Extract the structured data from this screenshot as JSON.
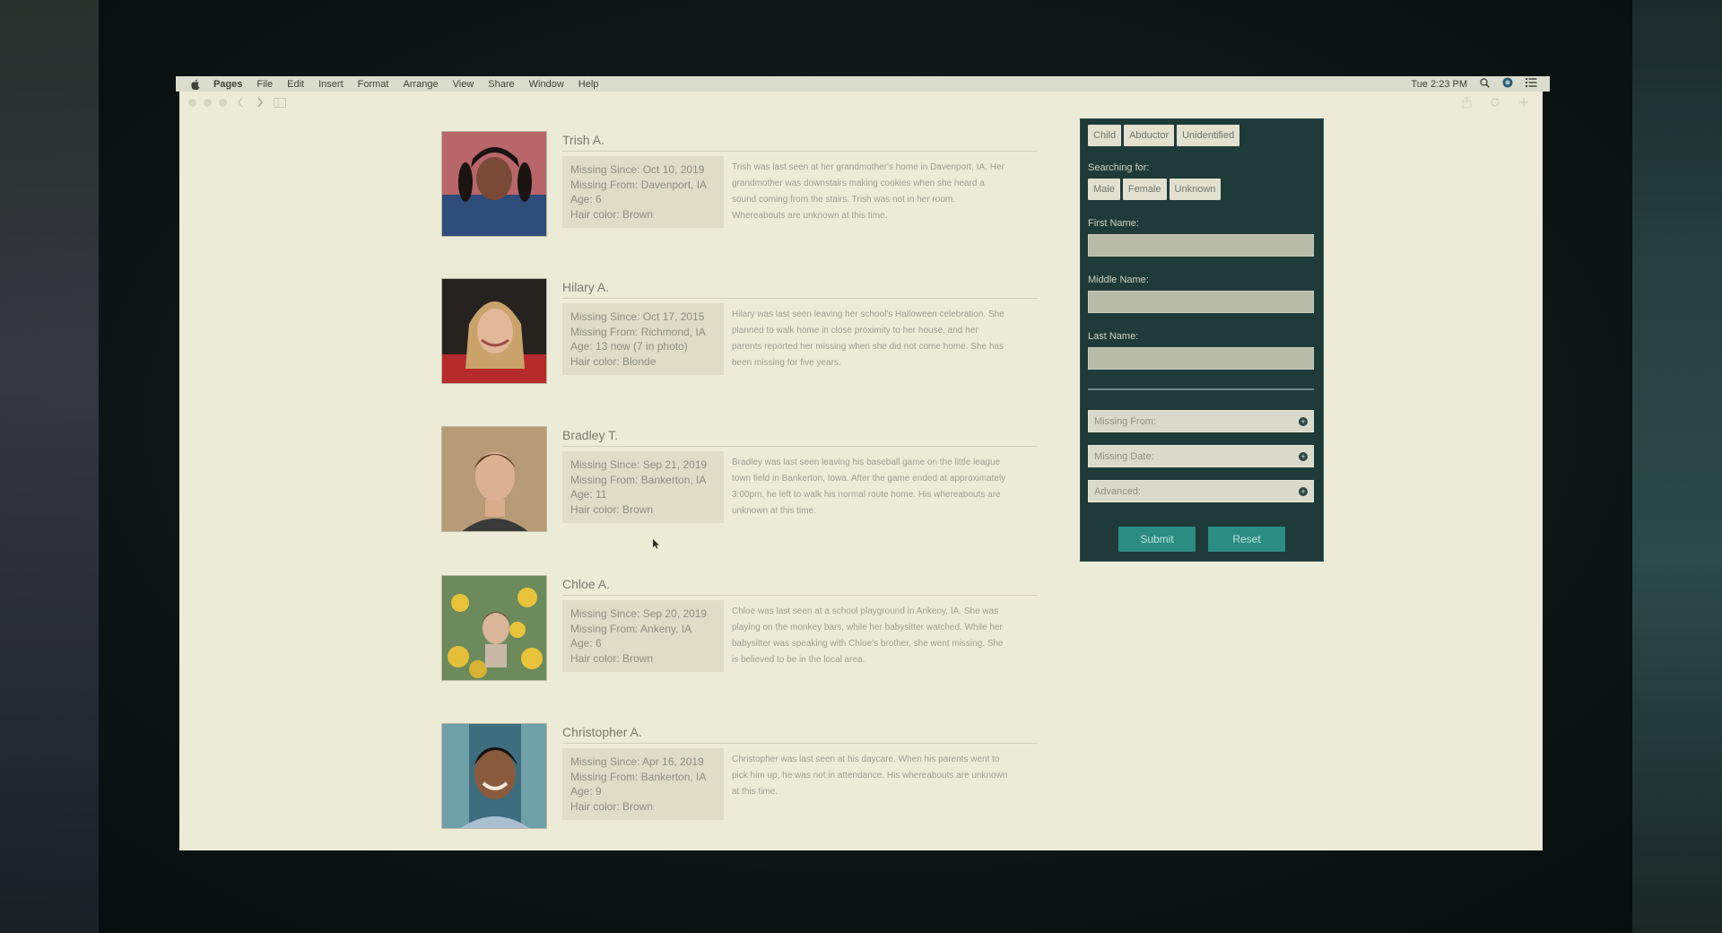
{
  "menubar": {
    "app": "Pages",
    "items": [
      "File",
      "Edit",
      "Insert",
      "Format",
      "Arrange",
      "View",
      "Share",
      "Window",
      "Help"
    ],
    "clock": "Tue 2:23 PM"
  },
  "profiles": [
    {
      "name": "Trish A.",
      "missing_since": "Missing Since: Oct 10, 2019",
      "missing_from": "Missing From: Davenport, IA",
      "age": "Age: 6",
      "hair": "Hair color: Brown",
      "description": "Trish was last seen at her grandmother's home in Davenport, IA. Her grandmother was downstairs making cookies when she heard a sound coming from the stairs. Trish was not in her room. Whereabouts are unknown at this time."
    },
    {
      "name": "Hilary A.",
      "missing_since": "Missing Since: Oct 17, 2015",
      "missing_from": "Missing From: Richmond, IA",
      "age": "Age: 13 now (7 in photo)",
      "hair": "Hair color: Blonde",
      "description": "Hilary was last seen leaving her school's Halloween celebration. She planned to walk home in close proximity to her house, and her parents reported her missing when she did not come home. She has been missing for five years."
    },
    {
      "name": "Bradley T.",
      "missing_since": "Missing Since: Sep 21, 2019",
      "missing_from": "Missing From: Bankerton, IA",
      "age": "Age: 11",
      "hair": "Hair color: Brown",
      "description": "Bradley was last seen leaving his baseball game on the little league town field in Bankerton, Iowa. After the game ended at approximately 3:00pm, he left to walk his normal route home. His whereabouts are unknown at this time."
    },
    {
      "name": "Chloe A.",
      "missing_since": "Missing Since: Sep 20, 2019",
      "missing_from": "Missing From: Ankeny, IA",
      "age": "Age: 6",
      "hair": "Hair color: Brown",
      "description": "Chloe was last seen at a school playground in Ankeny, IA. She was playing on the monkey bars, while her babysitter watched. While her babysitter was speaking with Chloe's brother, she went missing. She is believed to be in the local area."
    },
    {
      "name": "Christopher A.",
      "missing_since": "Missing Since: Apr 16, 2019",
      "missing_from": "Missing From: Bankerton, IA",
      "age": "Age: 9",
      "hair": "Hair color: Brown",
      "description": "Christopher was last seen at his daycare. When his parents went to pick him up, he was not in attendance. His whereabouts are unknown at this time."
    }
  ],
  "search": {
    "category_tabs": [
      "Child",
      "Abductor",
      "Unidentified"
    ],
    "searching_for_label": "Searching for:",
    "gender_options": [
      "Male",
      "Female",
      "Unknown"
    ],
    "first_name_label": "First Name:",
    "middle_name_label": "Middle Name:",
    "last_name_label": "Last Name:",
    "missing_from_label": "Missing From:",
    "missing_date_label": "Missing Date:",
    "advanced_label": "Advanced:",
    "submit_label": "Submit",
    "reset_label": "Reset"
  }
}
